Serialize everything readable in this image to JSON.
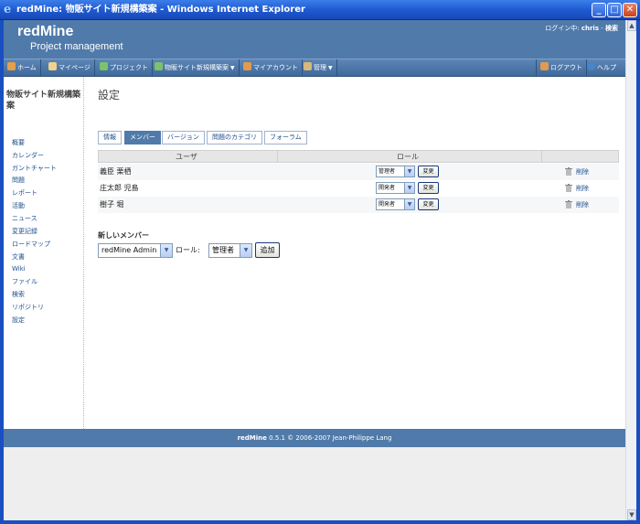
{
  "window": {
    "title": "redMine: 物販サイト新規構築案 - Windows Internet Explorer",
    "minimize": "_",
    "maximize": "□",
    "close": "✕"
  },
  "header": {
    "brand": "redMine",
    "subtitle": "Project management",
    "logged_as": "ログイン中:",
    "user": "chris",
    "separator": "-",
    "search": "検索"
  },
  "topmenu": {
    "items": [
      {
        "label": "ホーム",
        "icon": "home-icon",
        "color": "#e5a04a"
      },
      {
        "label": "マイページ",
        "icon": "mypage-icon",
        "color": "#f2d28a"
      },
      {
        "label": "プロジェクト",
        "icon": "projects-icon",
        "color": "#7cc26a"
      },
      {
        "label": "物販サイト新規構築案",
        "icon": "project-icon",
        "color": "#7cc26a"
      },
      {
        "label": "マイアカウント",
        "icon": "account-icon",
        "color": "#e39a4c"
      },
      {
        "label": "管理",
        "icon": "admin-icon",
        "color": "#d9b67a"
      },
      {
        "label": "ログアウト",
        "icon": "logout-icon",
        "color": "#e39a4c"
      },
      {
        "label": "ヘルプ",
        "icon": "help-icon",
        "color": "#4a84c8"
      }
    ]
  },
  "sidebar": {
    "project_title": "物販サイト新規構築案",
    "items": [
      "概要",
      "カレンダー",
      "ガントチャート",
      "問題",
      "レポート",
      "活動",
      "ニュース",
      "変更記録",
      "ロードマップ",
      "文書",
      "Wiki",
      "ファイル",
      "検索",
      "リポジトリ",
      "設定"
    ]
  },
  "content": {
    "title": "設定",
    "tabs": [
      "情報",
      "メンバー",
      "バージョン",
      "問題のカテゴリ",
      "フォーラム"
    ],
    "selected_tab": "メンバー",
    "columns": {
      "user": "ユーザ",
      "role": "ロール"
    },
    "members": [
      {
        "name": "義臣 栗栖",
        "role": "管理者",
        "change": "変更",
        "delete": "削除"
      },
      {
        "name": "庄太郎 児島",
        "role": "開発者",
        "change": "変更",
        "delete": "削除"
      },
      {
        "name": "樹子 堀",
        "role": "開発者",
        "change": "変更",
        "delete": "削除"
      }
    ],
    "new_member": {
      "heading": "新しいメンバー",
      "user_value": "redMine Admin",
      "role_label": "ロール:",
      "role_value": "管理者",
      "add_button": "追加"
    }
  },
  "footer": {
    "brand": "redMine",
    "text": "0.5.1 © 2006-2007 Jean-Philippe Lang"
  },
  "colors": {
    "header": "#507aaa",
    "menu": "#3f6a9c",
    "link": "#1f4f8f",
    "titlebar": "#1f5bd3"
  }
}
